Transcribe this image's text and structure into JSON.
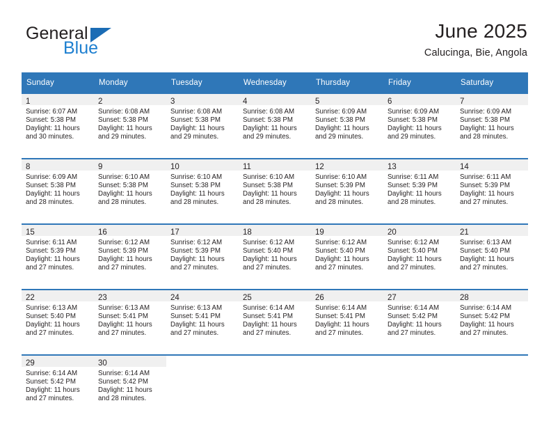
{
  "brand": {
    "name_part1": "General",
    "name_part2": "Blue",
    "triangle_icon": "triangle-logo-icon",
    "colors": {
      "blue": "#1d7fd0",
      "triangle": "#1b6cb5",
      "text": "#231f20"
    }
  },
  "header": {
    "title": "June 2025",
    "subtitle": "Calucinga, Bie, Angola"
  },
  "theme": {
    "header_blue": "#2f77b8",
    "daynum_band": "#f0f0f0",
    "cell_background": "#ffffff",
    "text": "#231f20"
  },
  "calendar": {
    "weekday_headers": [
      "Sunday",
      "Monday",
      "Tuesday",
      "Wednesday",
      "Thursday",
      "Friday",
      "Saturday"
    ],
    "weeks": [
      [
        {
          "day": "1",
          "sunrise": "Sunrise: 6:07 AM",
          "sunset": "Sunset: 5:38 PM",
          "daylight_line1": "Daylight: 11 hours",
          "daylight_line2": "and 30 minutes."
        },
        {
          "day": "2",
          "sunrise": "Sunrise: 6:08 AM",
          "sunset": "Sunset: 5:38 PM",
          "daylight_line1": "Daylight: 11 hours",
          "daylight_line2": "and 29 minutes."
        },
        {
          "day": "3",
          "sunrise": "Sunrise: 6:08 AM",
          "sunset": "Sunset: 5:38 PM",
          "daylight_line1": "Daylight: 11 hours",
          "daylight_line2": "and 29 minutes."
        },
        {
          "day": "4",
          "sunrise": "Sunrise: 6:08 AM",
          "sunset": "Sunset: 5:38 PM",
          "daylight_line1": "Daylight: 11 hours",
          "daylight_line2": "and 29 minutes."
        },
        {
          "day": "5",
          "sunrise": "Sunrise: 6:09 AM",
          "sunset": "Sunset: 5:38 PM",
          "daylight_line1": "Daylight: 11 hours",
          "daylight_line2": "and 29 minutes."
        },
        {
          "day": "6",
          "sunrise": "Sunrise: 6:09 AM",
          "sunset": "Sunset: 5:38 PM",
          "daylight_line1": "Daylight: 11 hours",
          "daylight_line2": "and 29 minutes."
        },
        {
          "day": "7",
          "sunrise": "Sunrise: 6:09 AM",
          "sunset": "Sunset: 5:38 PM",
          "daylight_line1": "Daylight: 11 hours",
          "daylight_line2": "and 28 minutes."
        }
      ],
      [
        {
          "day": "8",
          "sunrise": "Sunrise: 6:09 AM",
          "sunset": "Sunset: 5:38 PM",
          "daylight_line1": "Daylight: 11 hours",
          "daylight_line2": "and 28 minutes."
        },
        {
          "day": "9",
          "sunrise": "Sunrise: 6:10 AM",
          "sunset": "Sunset: 5:38 PM",
          "daylight_line1": "Daylight: 11 hours",
          "daylight_line2": "and 28 minutes."
        },
        {
          "day": "10",
          "sunrise": "Sunrise: 6:10 AM",
          "sunset": "Sunset: 5:38 PM",
          "daylight_line1": "Daylight: 11 hours",
          "daylight_line2": "and 28 minutes."
        },
        {
          "day": "11",
          "sunrise": "Sunrise: 6:10 AM",
          "sunset": "Sunset: 5:38 PM",
          "daylight_line1": "Daylight: 11 hours",
          "daylight_line2": "and 28 minutes."
        },
        {
          "day": "12",
          "sunrise": "Sunrise: 6:10 AM",
          "sunset": "Sunset: 5:39 PM",
          "daylight_line1": "Daylight: 11 hours",
          "daylight_line2": "and 28 minutes."
        },
        {
          "day": "13",
          "sunrise": "Sunrise: 6:11 AM",
          "sunset": "Sunset: 5:39 PM",
          "daylight_line1": "Daylight: 11 hours",
          "daylight_line2": "and 28 minutes."
        },
        {
          "day": "14",
          "sunrise": "Sunrise: 6:11 AM",
          "sunset": "Sunset: 5:39 PM",
          "daylight_line1": "Daylight: 11 hours",
          "daylight_line2": "and 27 minutes."
        }
      ],
      [
        {
          "day": "15",
          "sunrise": "Sunrise: 6:11 AM",
          "sunset": "Sunset: 5:39 PM",
          "daylight_line1": "Daylight: 11 hours",
          "daylight_line2": "and 27 minutes."
        },
        {
          "day": "16",
          "sunrise": "Sunrise: 6:12 AM",
          "sunset": "Sunset: 5:39 PM",
          "daylight_line1": "Daylight: 11 hours",
          "daylight_line2": "and 27 minutes."
        },
        {
          "day": "17",
          "sunrise": "Sunrise: 6:12 AM",
          "sunset": "Sunset: 5:39 PM",
          "daylight_line1": "Daylight: 11 hours",
          "daylight_line2": "and 27 minutes."
        },
        {
          "day": "18",
          "sunrise": "Sunrise: 6:12 AM",
          "sunset": "Sunset: 5:40 PM",
          "daylight_line1": "Daylight: 11 hours",
          "daylight_line2": "and 27 minutes."
        },
        {
          "day": "19",
          "sunrise": "Sunrise: 6:12 AM",
          "sunset": "Sunset: 5:40 PM",
          "daylight_line1": "Daylight: 11 hours",
          "daylight_line2": "and 27 minutes."
        },
        {
          "day": "20",
          "sunrise": "Sunrise: 6:12 AM",
          "sunset": "Sunset: 5:40 PM",
          "daylight_line1": "Daylight: 11 hours",
          "daylight_line2": "and 27 minutes."
        },
        {
          "day": "21",
          "sunrise": "Sunrise: 6:13 AM",
          "sunset": "Sunset: 5:40 PM",
          "daylight_line1": "Daylight: 11 hours",
          "daylight_line2": "and 27 minutes."
        }
      ],
      [
        {
          "day": "22",
          "sunrise": "Sunrise: 6:13 AM",
          "sunset": "Sunset: 5:40 PM",
          "daylight_line1": "Daylight: 11 hours",
          "daylight_line2": "and 27 minutes."
        },
        {
          "day": "23",
          "sunrise": "Sunrise: 6:13 AM",
          "sunset": "Sunset: 5:41 PM",
          "daylight_line1": "Daylight: 11 hours",
          "daylight_line2": "and 27 minutes."
        },
        {
          "day": "24",
          "sunrise": "Sunrise: 6:13 AM",
          "sunset": "Sunset: 5:41 PM",
          "daylight_line1": "Daylight: 11 hours",
          "daylight_line2": "and 27 minutes."
        },
        {
          "day": "25",
          "sunrise": "Sunrise: 6:14 AM",
          "sunset": "Sunset: 5:41 PM",
          "daylight_line1": "Daylight: 11 hours",
          "daylight_line2": "and 27 minutes."
        },
        {
          "day": "26",
          "sunrise": "Sunrise: 6:14 AM",
          "sunset": "Sunset: 5:41 PM",
          "daylight_line1": "Daylight: 11 hours",
          "daylight_line2": "and 27 minutes."
        },
        {
          "day": "27",
          "sunrise": "Sunrise: 6:14 AM",
          "sunset": "Sunset: 5:42 PM",
          "daylight_line1": "Daylight: 11 hours",
          "daylight_line2": "and 27 minutes."
        },
        {
          "day": "28",
          "sunrise": "Sunrise: 6:14 AM",
          "sunset": "Sunset: 5:42 PM",
          "daylight_line1": "Daylight: 11 hours",
          "daylight_line2": "and 27 minutes."
        }
      ],
      [
        {
          "day": "29",
          "sunrise": "Sunrise: 6:14 AM",
          "sunset": "Sunset: 5:42 PM",
          "daylight_line1": "Daylight: 11 hours",
          "daylight_line2": "and 27 minutes."
        },
        {
          "day": "30",
          "sunrise": "Sunrise: 6:14 AM",
          "sunset": "Sunset: 5:42 PM",
          "daylight_line1": "Daylight: 11 hours",
          "daylight_line2": "and 28 minutes."
        },
        {
          "day": "",
          "sunrise": "",
          "sunset": "",
          "daylight_line1": "",
          "daylight_line2": ""
        },
        {
          "day": "",
          "sunrise": "",
          "sunset": "",
          "daylight_line1": "",
          "daylight_line2": ""
        },
        {
          "day": "",
          "sunrise": "",
          "sunset": "",
          "daylight_line1": "",
          "daylight_line2": ""
        },
        {
          "day": "",
          "sunrise": "",
          "sunset": "",
          "daylight_line1": "",
          "daylight_line2": ""
        },
        {
          "day": "",
          "sunrise": "",
          "sunset": "",
          "daylight_line1": "",
          "daylight_line2": ""
        }
      ]
    ]
  }
}
